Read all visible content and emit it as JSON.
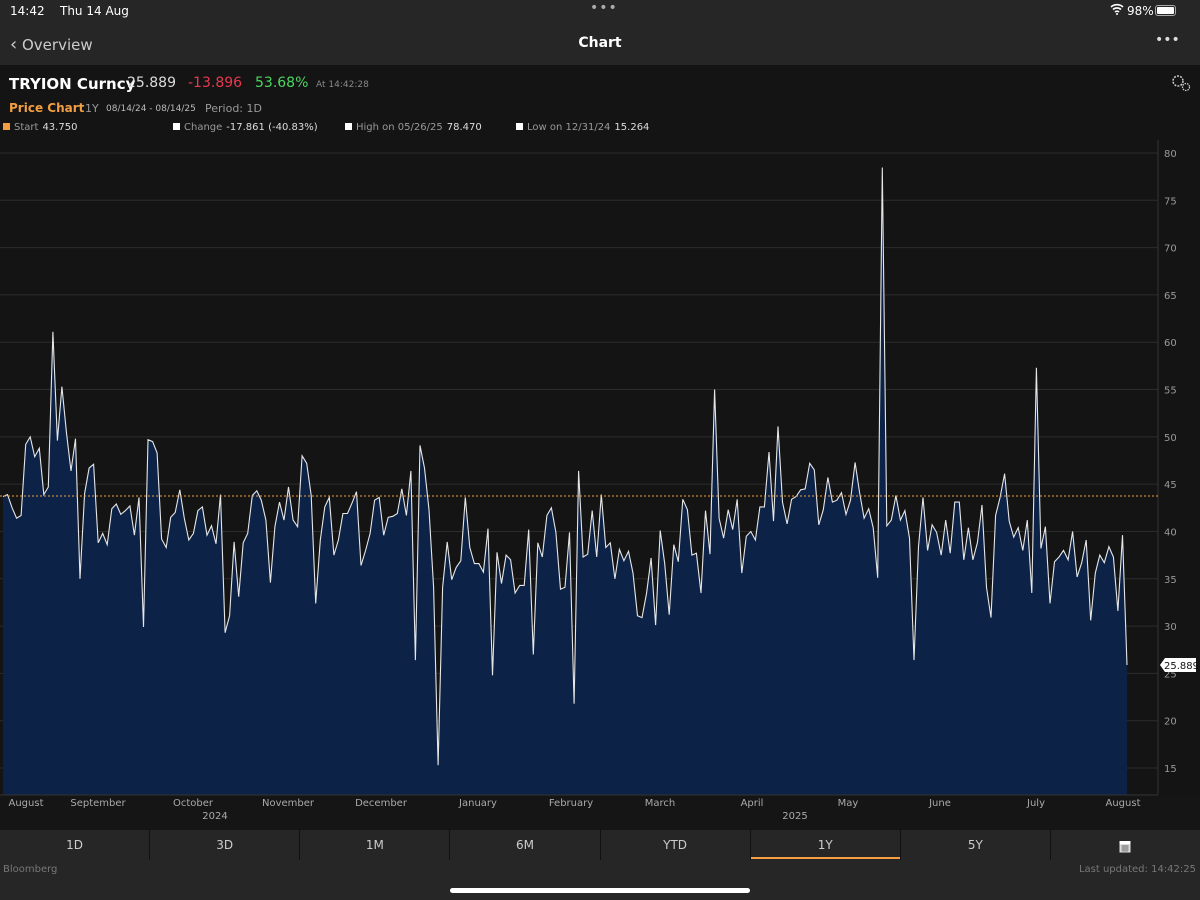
{
  "status_bar": {
    "time": "14:42",
    "date": "Thu 14 Aug",
    "battery": "98%",
    "icons": [
      "wifi-icon",
      "battery-icon"
    ]
  },
  "nav": {
    "back_label": "Overview",
    "title": "Chart",
    "more_icon": "ellipsis-icon"
  },
  "quote": {
    "ticker": "TRYION Curncy",
    "price": "25.889",
    "change": "-13.896",
    "change_pct": "53.68%",
    "as_of": "At 14:42:28",
    "settings_icon": "gears-icon"
  },
  "chart_header": {
    "label": "Price Chart",
    "range": "1Y",
    "dates": "08/14/24 - 08/14/25",
    "period": "Period: 1D"
  },
  "legend": {
    "start_label": "Start",
    "start_value": "43.750",
    "change_label": "Change",
    "change_value": "-17.861 (-40.83%)",
    "high_label": "High on 05/26/25",
    "high_value": "78.470",
    "low_label": "Low on 12/31/24",
    "low_value": "15.264"
  },
  "colors": {
    "accent": "#f39f41",
    "negative": "#e8384f",
    "positive": "#4bd762",
    "area": "#0c2347",
    "line": "#e6e6e6"
  },
  "chart_data": {
    "type": "area",
    "ylim": [
      12,
      81
    ],
    "yticks": [
      "15",
      "20",
      "25",
      "30",
      "35",
      "40",
      "45",
      "50",
      "55",
      "60",
      "65",
      "70",
      "75",
      "80"
    ],
    "xticks": [
      "August",
      "September",
      "October",
      "November",
      "December",
      "January",
      "February",
      "March",
      "April",
      "May",
      "June",
      "July",
      "August"
    ],
    "year_labels": [
      "2024",
      "2025"
    ],
    "reference_line": 43.75,
    "last_value_label": "25.889",
    "grid": true,
    "values": [
      43.7,
      43.9,
      42.5,
      41.4,
      41.7,
      49.2,
      50,
      47.9,
      48.8,
      43.9,
      44.7,
      61.1,
      49.6,
      55.3,
      50.4,
      46.4,
      49.8,
      35,
      44,
      46.7,
      47.1,
      38.8,
      39.8,
      38.6,
      42.4,
      42.9,
      41.8,
      42.2,
      42.7,
      39.6,
      43.6,
      29.9,
      49.7,
      49.5,
      48.3,
      39.2,
      38.3,
      41.5,
      42,
      44.4,
      41.4,
      39.1,
      39.8,
      42.2,
      42.6,
      39.6,
      40.6,
      38.7,
      43.9,
      29.3,
      31.1,
      38.9,
      33.1,
      38.8,
      39.8,
      43.8,
      44.3,
      43.3,
      41.2,
      34.6,
      40.5,
      43.1,
      41.2,
      44.7,
      41.2,
      40.5,
      48,
      47.2,
      43.8,
      32.4,
      39.1,
      42.6,
      43.6,
      37.5,
      39.1,
      41.9,
      41.9,
      43,
      44.2,
      36.4,
      38,
      39.8,
      43.3,
      43.6,
      39.6,
      41.5,
      41.6,
      41.9,
      44.5,
      41.7,
      46.4,
      26.4,
      49.1,
      46.7,
      42.3,
      34.1,
      15.3,
      34.1,
      38.9,
      34.9,
      36.2,
      36.9,
      43.6,
      38.3,
      36.6,
      36.6,
      35.7,
      40.3,
      24.8,
      37.8,
      34.5,
      37.5,
      37,
      33.5,
      34.3,
      34.3,
      40.2,
      27,
      38.8,
      37.3,
      41.7,
      42.5,
      39.9,
      33.9,
      34.1,
      39.9,
      21.8,
      46.4,
      37.3,
      37.6,
      42.2,
      37.3,
      43.9,
      38.3,
      38.8,
      35,
      38.1,
      36.9,
      37.9,
      35.6,
      31.1,
      30.9,
      33.5,
      37.2,
      30.1,
      40.1,
      36.6,
      31.2,
      38.6,
      36.8,
      43.4,
      42.3,
      37.5,
      37.7,
      33.5,
      42.2,
      37.6,
      55,
      41.4,
      39.3,
      42.3,
      40.2,
      43.4,
      35.6,
      39.5,
      40,
      39.1,
      42.6,
      42.6,
      48.4,
      41.1,
      51.1,
      43.1,
      40.8,
      43.4,
      43.7,
      44.4,
      44.5,
      47.2,
      46.5,
      40.7,
      42.3,
      45.7,
      43.1,
      43.3,
      44.1,
      41.8,
      43.3,
      47.3,
      44.1,
      41.4,
      42.4,
      40.4,
      35.1,
      78.47,
      40.6,
      41.2,
      43.8,
      41.2,
      42.2,
      39.3,
      26.4,
      38.4,
      43.6,
      38,
      40.7,
      39.9,
      37.5,
      41.2,
      37.7,
      43.1,
      43.1,
      37,
      40.4,
      37,
      38.8,
      42.8,
      34.1,
      30.9,
      41.7,
      43.6,
      46.1,
      41.1,
      39.4,
      40.4,
      38,
      41.2,
      33.5,
      57.3,
      38.2,
      40.5,
      32.4,
      36.8,
      37.3,
      38,
      37,
      40,
      35.2,
      36.7,
      39.1,
      30.6,
      35.6,
      37.5,
      36.7,
      38.4,
      37.3,
      31.6,
      39.6,
      25.889
    ]
  },
  "range_tabs": [
    "1D",
    "3D",
    "1M",
    "6M",
    "YTD",
    "1Y",
    "5Y"
  ],
  "active_tab": "1Y",
  "calendar_icon": "calendar-icon",
  "footer": {
    "source": "Bloomberg",
    "updated": "Last updated: 14:42:25"
  }
}
